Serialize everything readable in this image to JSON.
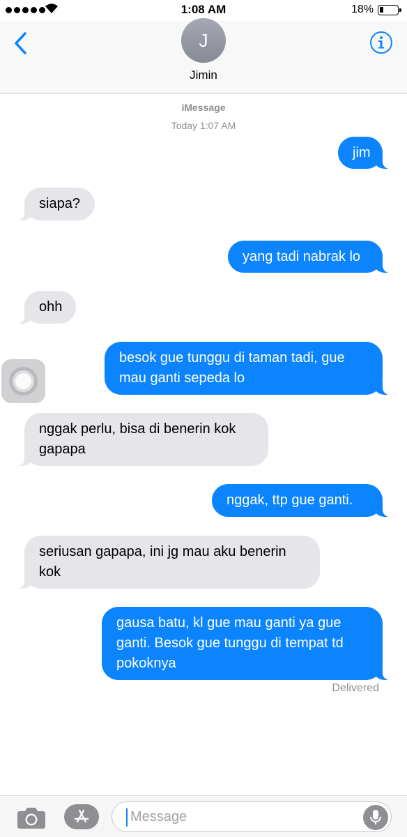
{
  "status_bar": {
    "time": "1:08 AM",
    "battery_percent": "18%",
    "signal_bars": 5,
    "battery_level": 0.18
  },
  "header": {
    "contact_initial": "J",
    "contact_name": "Jimin",
    "back_icon": "chevron-left-icon",
    "info_icon": "info-circle-icon"
  },
  "thread": {
    "service": "iMessage",
    "timestamp": "Today 1:07 AM",
    "messages": [
      {
        "from": "me",
        "text": "jim"
      },
      {
        "from": "them",
        "text": "siapa?"
      },
      {
        "from": "me",
        "text": "yang tadi nabrak lo"
      },
      {
        "from": "them",
        "text": "ohh"
      },
      {
        "from": "me",
        "text": "besok gue tunggu di taman tadi, gue mau ganti sepeda lo"
      },
      {
        "from": "them",
        "text": "nggak perlu, bisa di benerin kok gapapa"
      },
      {
        "from": "me",
        "text": "nggak, ttp gue ganti."
      },
      {
        "from": "them",
        "text": "seriusan gapapa, ini jg mau aku benerin kok"
      },
      {
        "from": "me",
        "text": "gausa batu, kl gue mau ganti ya gue ganti. Besok gue tunggu di tempat td pokoknya"
      }
    ],
    "delivery_status": "Delivered"
  },
  "input_bar": {
    "placeholder": "Message",
    "camera_icon": "camera-icon",
    "apps_icon": "app-store-icon",
    "mic_icon": "microphone-icon"
  },
  "colors": {
    "outgoing_bubble": "#0b84fe",
    "incoming_bubble": "#e5e5ea",
    "accent": "#0b84fe",
    "meta_text": "#8e8e93"
  }
}
